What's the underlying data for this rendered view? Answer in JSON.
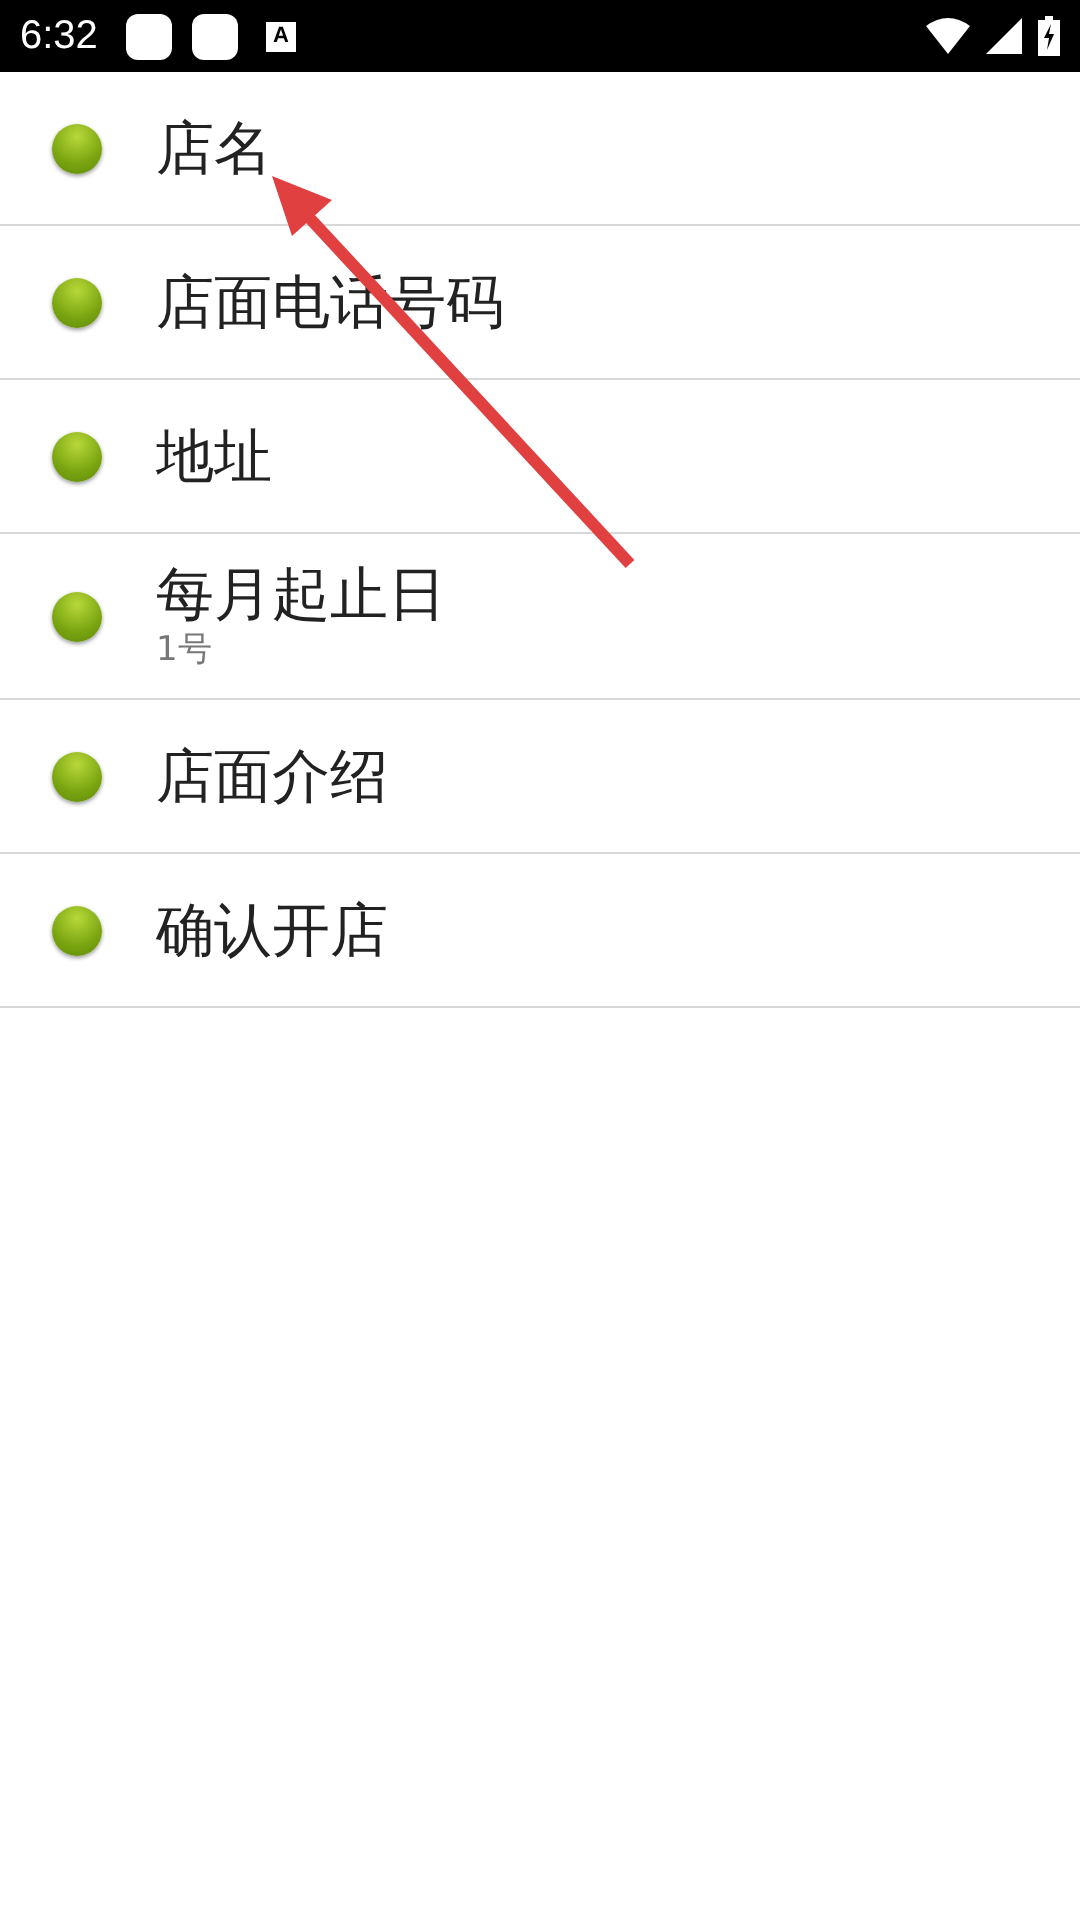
{
  "status_bar": {
    "time": "6:32",
    "notification_glyph": "A"
  },
  "settings": [
    {
      "title": "店名"
    },
    {
      "title": "店面电话号码"
    },
    {
      "title": "地址"
    },
    {
      "title": "每月起止日",
      "summary": "1号"
    },
    {
      "title": "店面介绍"
    },
    {
      "title": "确认开店"
    }
  ]
}
